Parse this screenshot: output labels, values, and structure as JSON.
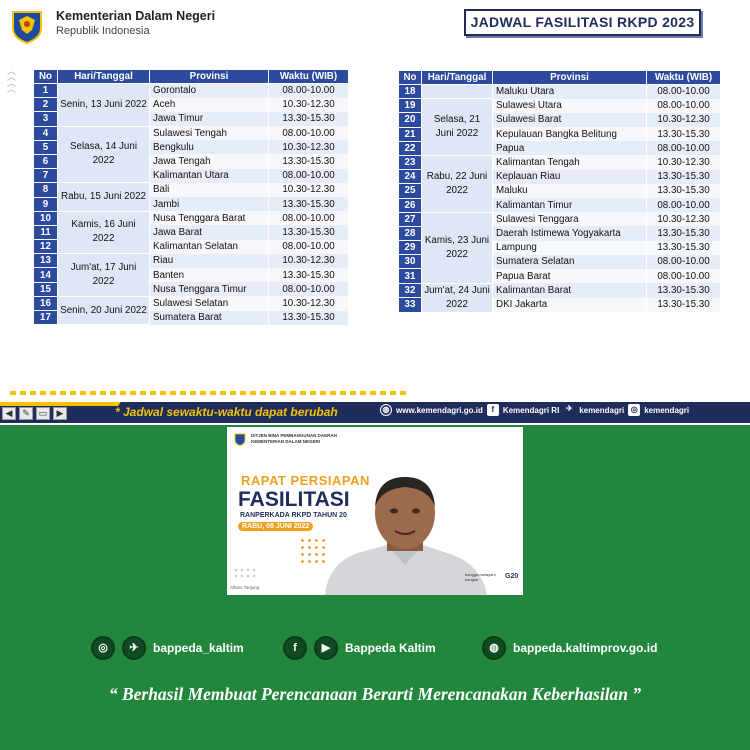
{
  "header": {
    "ministry": "Kementerian Dalam Negeri",
    "republic": "Republik Indonesia",
    "title": "JADWAL FASILITASI RKPD 2023"
  },
  "colors": {
    "navy": "#1f2d5c",
    "header_blue": "#2c4a9e",
    "yellow": "#f2c300",
    "green": "#22873c"
  },
  "table_headers": {
    "no": "No",
    "day": "Hari/Tanggal",
    "province": "Provinsi",
    "time": "Waktu (WIB)"
  },
  "table1": {
    "days": [
      {
        "label": "Senin, 13 Juni 2022",
        "rows": 3
      },
      {
        "label": "Selasa, 14 Juni 2022",
        "rows": 4
      },
      {
        "label": "Rabu, 15 Juni 2022",
        "rows": 2
      },
      {
        "label": "Kamis, 16 Juni 2022",
        "rows": 3
      },
      {
        "label": "Jum'at, 17 Juni 2022",
        "rows": 3
      },
      {
        "label": "Senin, 20 Juni 2022",
        "rows": 3
      }
    ],
    "rows": [
      {
        "no": "1",
        "province": "Gorontalo",
        "time": "08.00-10.00"
      },
      {
        "no": "2",
        "province": "Aceh",
        "time": "10.30-12.30"
      },
      {
        "no": "3",
        "province": "Jawa Timur",
        "time": "13.30-15.30"
      },
      {
        "no": "4",
        "province": "Sulawesi Tengah",
        "time": "08.00-10.00"
      },
      {
        "no": "5",
        "province": "Bengkulu",
        "time": "10.30-12.30"
      },
      {
        "no": "6",
        "province": "Jawa Tengah",
        "time": "13.30-15.30"
      },
      {
        "no": "7",
        "province": "Kalimantan Utara",
        "time": "08.00-10.00"
      },
      {
        "no": "8",
        "province": "Bali",
        "time": "10.30-12.30"
      },
      {
        "no": "9",
        "province": "Jambi",
        "time": "13.30-15.30"
      },
      {
        "no": "10",
        "province": "Nusa Tenggara Barat",
        "time": "08.00-10.00"
      },
      {
        "no": "11",
        "province": "Jawa Barat",
        "time": "13.30-15.30"
      },
      {
        "no": "12",
        "province": "Kalimantan Selatan",
        "time": "08.00-10.00"
      },
      {
        "no": "13",
        "province": "Riau",
        "time": "10.30-12.30"
      },
      {
        "no": "14",
        "province": "Banten",
        "time": "13.30-15.30"
      },
      {
        "no": "15",
        "province": "Nusa Tenggara Timur",
        "time": "08.00-10.00"
      },
      {
        "no": "16",
        "province": "Sulawesi Selatan",
        "time": "10.30-12.30"
      },
      {
        "no": "17",
        "province": "Sumatera Barat",
        "time": "13.30-15.30"
      }
    ]
  },
  "table2": {
    "days": [
      {
        "label": "",
        "rows": 1
      },
      {
        "label": "Selasa, 21 Juni 2022",
        "rows": 4
      },
      {
        "label": "Rabu, 22 Juni 2022",
        "rows": 4
      },
      {
        "label": "Kamis, 23 Juni 2022",
        "rows": 5
      },
      {
        "label": "Jum'at, 24 Juni 2022",
        "rows": 3
      }
    ],
    "rows": [
      {
        "no": "18",
        "province": "Maluku Utara",
        "time": "08.00-10.00"
      },
      {
        "no": "19",
        "province": "Sulawesi Utara",
        "time": "08.00-10.00"
      },
      {
        "no": "20",
        "province": "Sulawesi Barat",
        "time": "10.30-12.30"
      },
      {
        "no": "21",
        "province": "Kepulauan Bangka Belitung",
        "time": "13.30-15.30"
      },
      {
        "no": "22",
        "province": "Papua",
        "time": "08.00-10.00"
      },
      {
        "no": "23",
        "province": "Kalimantan Tengah",
        "time": "10.30-12.30"
      },
      {
        "no": "24",
        "province": "Keplauan Riau",
        "time": "13.30-15.30"
      },
      {
        "no": "25",
        "province": "Maluku",
        "time": "13.30-15.30"
      },
      {
        "no": "26",
        "province": "Kalimantan Timur",
        "time": "08.00-10.00"
      },
      {
        "no": "27",
        "province": "Sulawesi Tenggara",
        "time": "10.30-12.30"
      },
      {
        "no": "28",
        "province": "Daerah Istimewa Yogyakarta",
        "time": "13.30-15.30"
      },
      {
        "no": "29",
        "province": "Lampung",
        "time": "13.30-15.30"
      },
      {
        "no": "30",
        "province": "Sumatera Selatan",
        "time": "08.00-10.00"
      },
      {
        "no": "31",
        "province": "Papua Barat",
        "time": "08.00-10.00"
      },
      {
        "no": "32",
        "province": "Kalimantan Barat",
        "time": "13.30-15.30"
      },
      {
        "no": "33",
        "province": "DKI Jakarta",
        "time": "13.30-15.30"
      }
    ]
  },
  "footer": {
    "disclaimer": "* Jadwal sewaktu-waktu dapat berubah",
    "website": "www.kemendagri.go.id",
    "facebook": "Kemendagri RI",
    "twitter": "kemendagri",
    "instagram": "kemendagri"
  },
  "video": {
    "header_line1": "DITJEN BINA PEMBANGUNAN DAERAH",
    "header_line2": "KEMENTERIAN DALAM NEGERI",
    "rapat": "RAPAT PERSIAPAN",
    "fasilitasi": "FASILITASI",
    "ranperkada": "RANPERKADA RKPD TAHUN 20",
    "date": "RABU, 08 JUNI 2022",
    "participant": "Alfans Tanjung",
    "bangga": "bangga melayani bangsa",
    "g20": "G20"
  },
  "social": {
    "handle1": "bappeda_kaltim",
    "handle2": "Bappeda Kaltim",
    "website": "bappeda.kaltimprov.go.id"
  },
  "tagline": "“ Berhasil  Membuat Perencanaan Berarti Merencanakan Keberhasilan ”"
}
